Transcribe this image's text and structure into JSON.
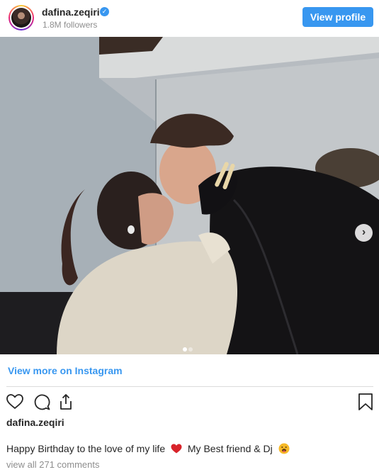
{
  "header": {
    "username": "dafina.zeqiri",
    "verified_mark": "✓",
    "followers": "1.8M followers",
    "view_profile_label": "View profile"
  },
  "photo": {
    "description_icon": "photo",
    "carousel_total": 2,
    "carousel_active": 1,
    "next_arrow": "›"
  },
  "links": {
    "view_more": "View more on Instagram"
  },
  "actions": {
    "icons": [
      "heart-icon",
      "comment-icon",
      "share-icon",
      "bookmark-icon"
    ]
  },
  "caption": {
    "username": "dafina.zeqiri",
    "text_before": "Happy Birthday to the love of my life",
    "text_after": "My Best friend & Dj",
    "emoji_1": "red-heart",
    "emoji_2": "face-with-tongue"
  },
  "comments": {
    "view_all": "view all 271 comments"
  },
  "colors": {
    "accent": "#3897f0",
    "text": "#262626",
    "muted": "#8e8e8e",
    "divider": "#dbdbdb"
  }
}
